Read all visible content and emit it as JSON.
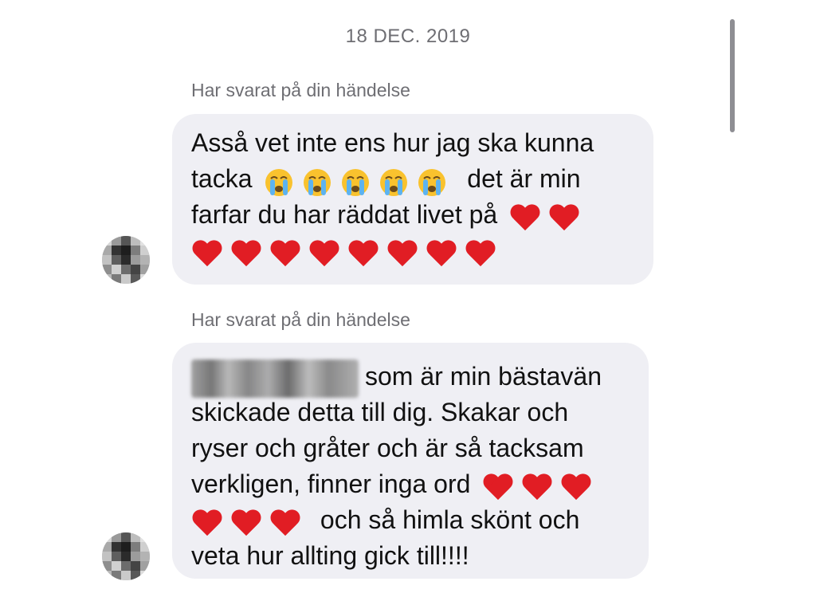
{
  "conversation": {
    "date_separator": "18 DEC. 2019",
    "messages": [
      {
        "reply_label": "Har svarat på din händelse",
        "line1": "Asså vet inte ens hur jag ska kunna",
        "line2_start": "tacka",
        "line2_emoji": "😭",
        "line2_emoji_count": 5,
        "line2_end": "det är min",
        "line3_start": "farfar du har räddat livet på",
        "line3_heart_count": 2,
        "line4_heart_count": 8,
        "heart_emoji": "❤️"
      },
      {
        "reply_label": "Har svarat på din händelse",
        "line1_after_redacted": "som är min bästavän",
        "line2": "skickade detta till dig. Skakar och",
        "line3": "ryser och gråter och är så tacksam",
        "line4_start": "verkligen, finner inga ord",
        "line4_heart_count": 3,
        "line5_heart_count": 3,
        "line5_end": "och så himla skönt och",
        "line6": "veta hur allting gick till!!!!"
      }
    ]
  },
  "colors": {
    "bubble_background": "#efeff4",
    "secondary_text": "#6e6e73",
    "heart": "#e11d24",
    "scrollbar": "#8e8e93"
  },
  "icons": {
    "crying_face": "loudly-crying-face-emoji",
    "heart": "red-heart-emoji",
    "avatar": "user-avatar-pixelated"
  }
}
